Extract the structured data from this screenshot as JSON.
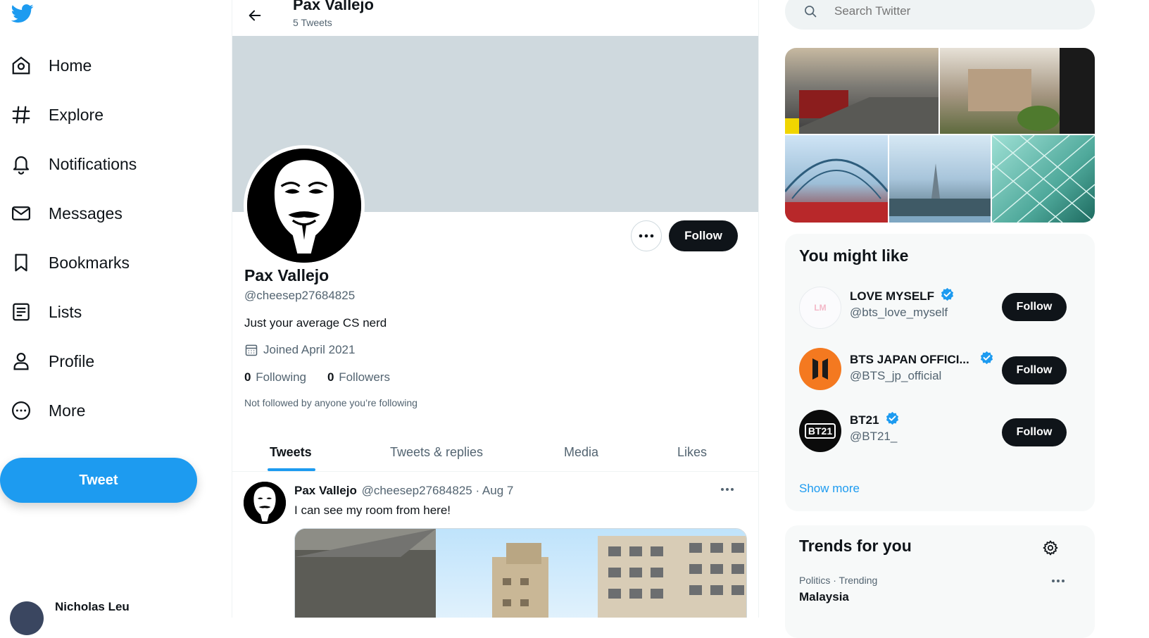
{
  "nav": {
    "items": [
      {
        "label": "Home",
        "icon": "home-icon"
      },
      {
        "label": "Explore",
        "icon": "hashtag-icon"
      },
      {
        "label": "Notifications",
        "icon": "bell-icon"
      },
      {
        "label": "Messages",
        "icon": "envelope-icon"
      },
      {
        "label": "Bookmarks",
        "icon": "bookmark-icon"
      },
      {
        "label": "Lists",
        "icon": "list-icon"
      },
      {
        "label": "Profile",
        "icon": "person-icon"
      },
      {
        "label": "More",
        "icon": "more-circle-icon"
      }
    ],
    "tweet_label": "Tweet",
    "account_name": "Nicholas Leu"
  },
  "header": {
    "title": "Pax Vallejo",
    "subtitle": "5 Tweets"
  },
  "profile": {
    "name": "Pax Vallejo",
    "handle": "@cheesep27684825",
    "bio": "Just your average CS nerd",
    "joined": "Joined April 2021",
    "following_count": "0",
    "following_label": "Following",
    "followers_count": "0",
    "followers_label": "Followers",
    "not_followed": "Not followed by anyone you’re following",
    "follow_label": "Follow"
  },
  "tabs": [
    "Tweets",
    "Tweets & replies",
    "Media",
    "Likes"
  ],
  "active_tab": "Tweets",
  "tweet": {
    "name": "Pax Vallejo",
    "handle_date": "@cheesep27684825 · Aug 7",
    "text": "I can see my room from here!"
  },
  "search": {
    "placeholder": "Search Twitter"
  },
  "suggestions": {
    "title": "You might like",
    "items": [
      {
        "name": "LOVE MYSELF",
        "handle": "@bts_love_myself",
        "verified": true,
        "follow": "Follow"
      },
      {
        "name": "BTS JAPAN OFFICI...",
        "handle": "@BTS_jp_official",
        "verified": true,
        "follow": "Follow"
      },
      {
        "name": "BT21",
        "handle": "@BT21_",
        "verified": true,
        "follow": "Follow"
      }
    ],
    "show_more": "Show more"
  },
  "trends": {
    "title": "Trends for you",
    "items": [
      {
        "context": "Politics · Trending",
        "name": "Malaysia"
      }
    ]
  },
  "colors": {
    "accent": "#1d9bf0",
    "banner": "#cfd9de",
    "text_secondary": "#536471",
    "bts_orange": "#f47920"
  }
}
